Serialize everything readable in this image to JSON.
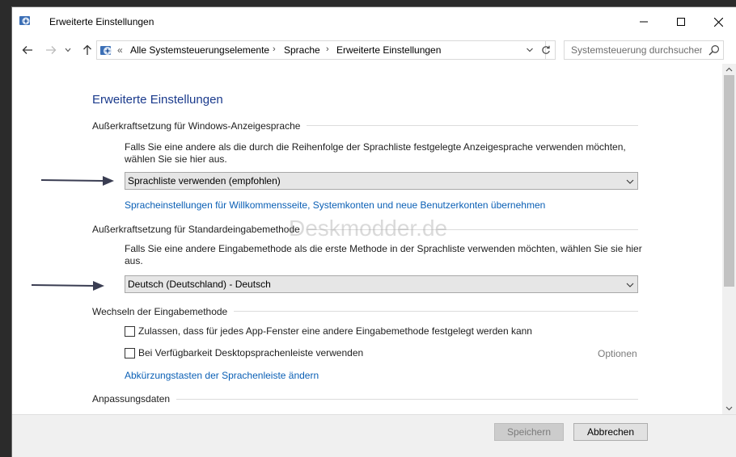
{
  "window": {
    "title": "Erweiterte Einstellungen"
  },
  "address": {
    "overflow": "«",
    "crumbs": [
      "Alle Systemsteuerungselemente",
      "Sprache",
      "Erweiterte Einstellungen"
    ],
    "search_placeholder": "Systemsteuerung durchsuchen"
  },
  "main": {
    "title": "Erweiterte Einstellungen",
    "display_lang": {
      "heading": "Außerkraftsetzung für Windows-Anzeigesprache",
      "description": "Falls Sie eine andere als die durch die Reihenfolge der Sprachliste festgelegte Anzeigesprache verwenden möchten, wählen Sie sie hier aus.",
      "selected": "Sprachliste verwenden (empfohlen)",
      "link": "Spracheinstellungen für Willkommensseite, Systemkonten und neue Benutzerkonten übernehmen"
    },
    "input_method": {
      "heading": "Außerkraftsetzung für Standardeingabemethode",
      "description": "Falls Sie eine andere Eingabemethode als die erste Methode in der Sprachliste verwenden möchten, wählen Sie sie hier aus.",
      "selected": "Deutsch (Deutschland) - Deutsch"
    },
    "switching": {
      "heading": "Wechseln der Eingabemethode",
      "checkbox1": "Zulassen, dass für jedes App-Fenster eine andere Eingabemethode festgelegt werden kann",
      "checkbox2": "Bei Verfügbarkeit Desktopsprachenleiste verwenden",
      "options_link": "Optionen",
      "hotkeys_link": "Abkürzungstasten der Sprachenleiste ändern"
    },
    "personalization": {
      "heading": "Anpassungsdaten"
    },
    "watermark": "Deskmodder.de"
  },
  "footer": {
    "save_label": "Speichern",
    "cancel_label": "Abbrechen"
  },
  "colors": {
    "title_blue": "#1a3a8c",
    "link_blue": "#0a5fb5",
    "arrow": "#3a3d52"
  },
  "icons": {
    "app": "control-panel-icon",
    "back": "arrow-left-icon",
    "forward": "arrow-right-icon",
    "up": "arrow-up-icon",
    "refresh": "refresh-icon",
    "search": "search-icon"
  }
}
